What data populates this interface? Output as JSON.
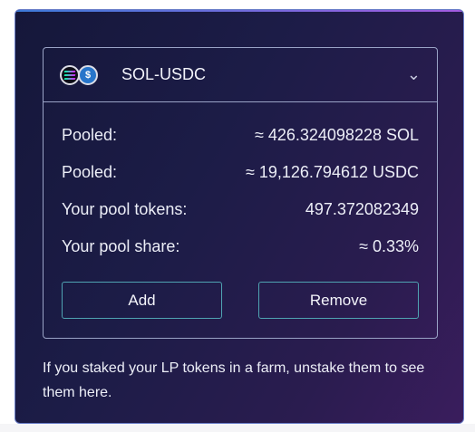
{
  "pool": {
    "pair_name": "SOL-USDC",
    "token_icons": [
      "solana-icon",
      "usdc-icon"
    ],
    "rows": [
      {
        "label": "Pooled:",
        "value": "≈ 426.324098228 SOL"
      },
      {
        "label": "Pooled:",
        "value": "≈ 19,126.794612 USDC"
      },
      {
        "label": "Your pool tokens:",
        "value": "497.372082349"
      },
      {
        "label": "Your pool share:",
        "value": "≈ 0.33%"
      }
    ],
    "add_label": "Add",
    "remove_label": "Remove"
  },
  "note": "If you staked your LP tokens in a farm, unstake them to see them here.",
  "colors": {
    "panel_bg_start": "#15173a",
    "panel_bg_end": "#3a1d5d",
    "button_border": "#4fa3b2",
    "text": "#eceef7"
  }
}
